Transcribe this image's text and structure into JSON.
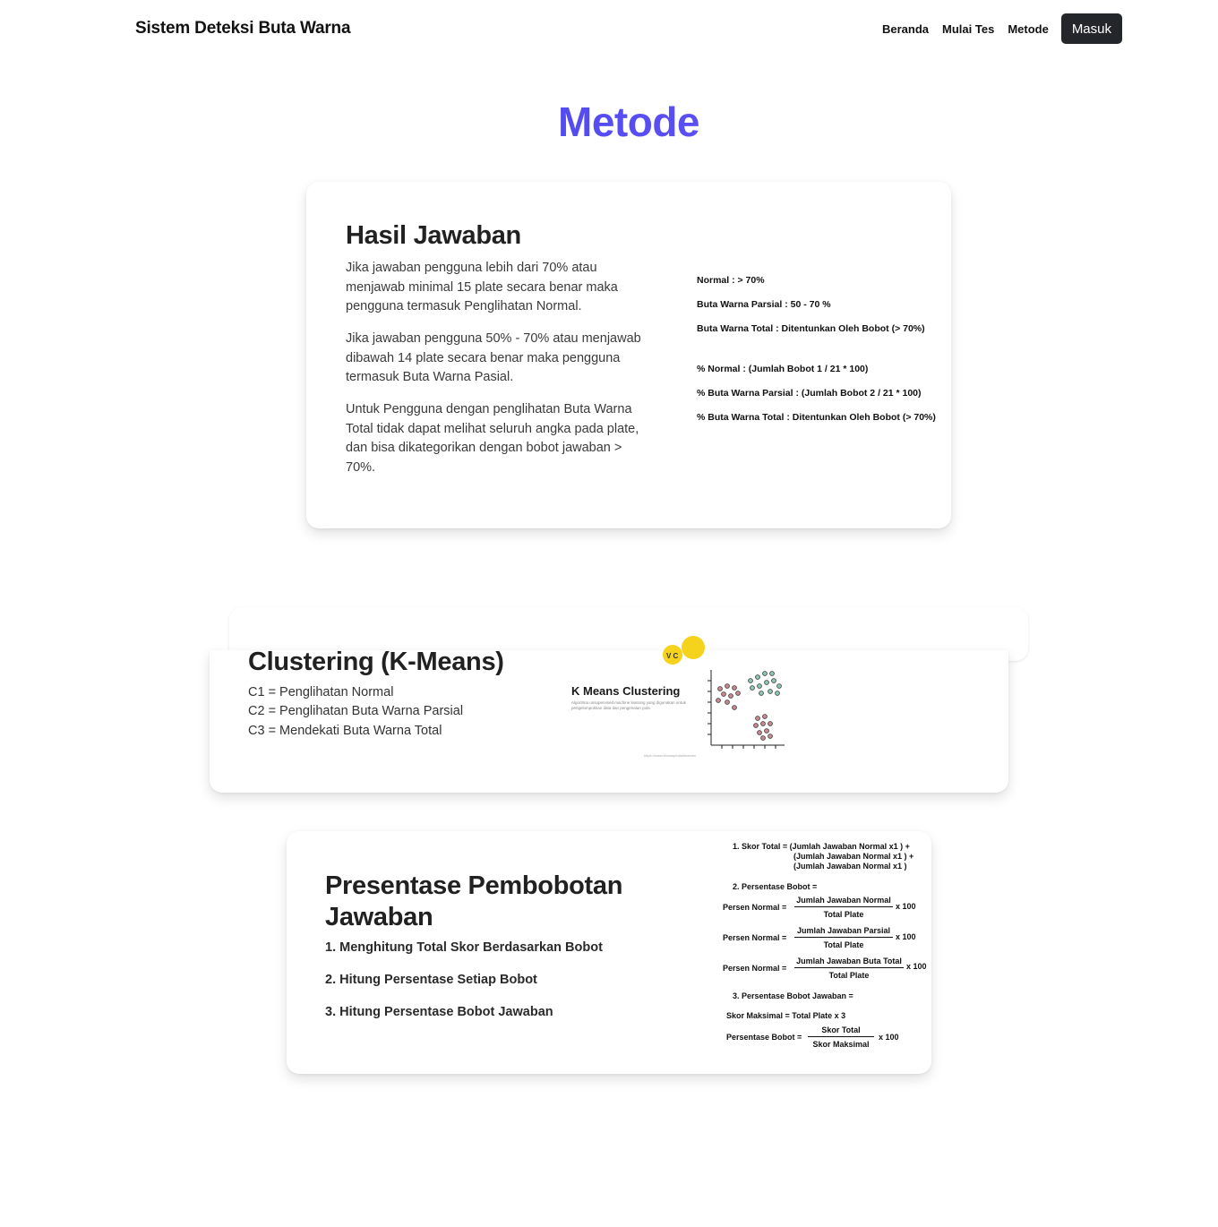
{
  "nav": {
    "brand": "Sistem Deteksi Buta Warna",
    "links": [
      "Beranda",
      "Mulai Tes",
      "Metode"
    ],
    "login": "Masuk"
  },
  "page_title": "Metode",
  "hasil": {
    "title": "Hasil Jawaban",
    "paragraphs": [
      "Jika jawaban pengguna lebih dari 70% atau menjawab minimal 15 plate secara benar maka pengguna termasuk Penglihatan Normal.",
      "Jika jawaban pengguna 50% - 70% atau menjawab dibawah 14 plate secara benar maka pengguna termasuk Buta Warna Pasial.",
      "Untuk Pengguna dengan penglihatan Buta Warna Total tidak dapat melihat seluruh angka pada plate, dan bisa dikategorikan dengan bobot jawaban > 70%."
    ],
    "rules": [
      "Normal : > 70%",
      "Buta Warna Parsial : 50 - 70 %",
      "Buta Warna Total : Ditentunkan Oleh Bobot (> 70%)",
      "% Normal : (Jumlah Bobot 1 / 21 * 100)",
      "% Buta Warna Parsial : (Jumlah Bobot 2 / 21 * 100)",
      "% Buta Warna Total : Ditentunkan Oleh Bobot (> 70%)"
    ]
  },
  "clustering": {
    "title": "Clustering (K-Means)",
    "items": [
      "C1 = Penglihatan Normal",
      "C2 = Penglihatan Buta Warna Parsial",
      "C3 = Mendekati Buta Warna Total"
    ],
    "image": {
      "heading": "K Means Clustering",
      "caption": "Algoritma unsupervised machine learning yang digunakan untuk pengelompokkan data dan pengenalan pola.",
      "badge": "V C",
      "url": "https://www.trivusspedia/knames"
    }
  },
  "pembobotan": {
    "title": "Presentase Pembobotan Jawaban",
    "steps": [
      "1. Menghitung Total Skor Berdasarkan Bobot",
      "2. Hitung Persentase Setiap Bobot",
      "3. Hitung Persentase Bobot Jawaban"
    ],
    "formula": {
      "f1_label": "1.  Skor Total = (Jumlah Jawaban Normal x1 )  +",
      "f1_line2": "(Jumlah Jawaban Normal x1 )  +",
      "f1_line3": "(Jumlah Jawaban Normal x1 )",
      "f2_label": "2. Persentase Bobot =",
      "persen_normal": "Persen Normal =",
      "num_normal": "Jumlah Jawaban Normal",
      "num_parsial": "Jumlah Jawaban Parsial",
      "num_total": "Jumlah Jawaban Buta Total",
      "den_plate": "Total Plate",
      "x100": "x 100",
      "f3_label": "3. Persentase Bobot Jawaban =",
      "skor_maks": "Skor Maksimal = Total Plate x 3",
      "persentase_bobot": "Persentase Bobot =",
      "num_skor": "Skor Total",
      "den_skor": "Skor Maksimal"
    }
  }
}
